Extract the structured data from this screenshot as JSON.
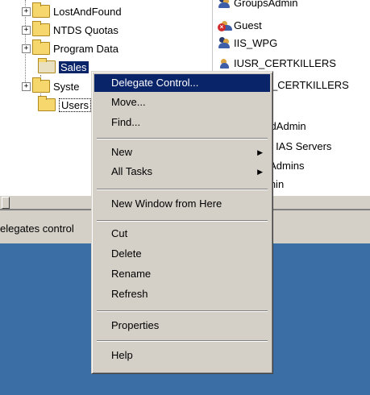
{
  "tree": {
    "items": [
      {
        "label": "LostAndFound",
        "expander": "+"
      },
      {
        "label": "NTDS Quotas",
        "expander": "+"
      },
      {
        "label": "Program Data",
        "expander": "+"
      },
      {
        "label": "Sales",
        "expander": ""
      },
      {
        "label": "Syste",
        "expander": "+"
      },
      {
        "label": "Users",
        "expander": ""
      }
    ]
  },
  "list": {
    "items": [
      {
        "label": "GroupsAdmin",
        "icon": "group-icon"
      },
      {
        "label": "Guest",
        "icon": "disabled-user-icon"
      },
      {
        "label": "IIS_WPG",
        "icon": "group-icon"
      },
      {
        "label": "IUSR_CERTKILLERS",
        "icon": "user-icon"
      },
      {
        "label": "_CERTKILLERS",
        "icon": "user-icon"
      },
      {
        "label": "ordAdmin",
        "icon": "user-icon"
      },
      {
        "label": "nd IAS Servers",
        "icon": "group-icon"
      },
      {
        "label": "a Admins",
        "icon": "group-icon"
      },
      {
        "label": "dmin",
        "icon": "user-icon"
      }
    ]
  },
  "status": {
    "text": "elegates control"
  },
  "context_menu": {
    "items": [
      {
        "label": "Delegate Control...",
        "highlighted": true,
        "submenu": false
      },
      {
        "label": "Move...",
        "submenu": false
      },
      {
        "label": "Find...",
        "submenu": false
      },
      {
        "label": "New",
        "submenu": true
      },
      {
        "label": "All Tasks",
        "submenu": true
      },
      {
        "label": "New Window from Here",
        "submenu": false
      },
      {
        "label": "Cut",
        "submenu": false
      },
      {
        "label": "Delete",
        "submenu": false
      },
      {
        "label": "Rename",
        "submenu": false
      },
      {
        "label": "Refresh",
        "submenu": false
      },
      {
        "label": "Properties",
        "submenu": false
      },
      {
        "label": "Help",
        "submenu": false
      }
    ]
  },
  "colors": {
    "selection": "#0a246a",
    "menu_face": "#d4d0c8",
    "desktop": "#3a6ea5"
  }
}
